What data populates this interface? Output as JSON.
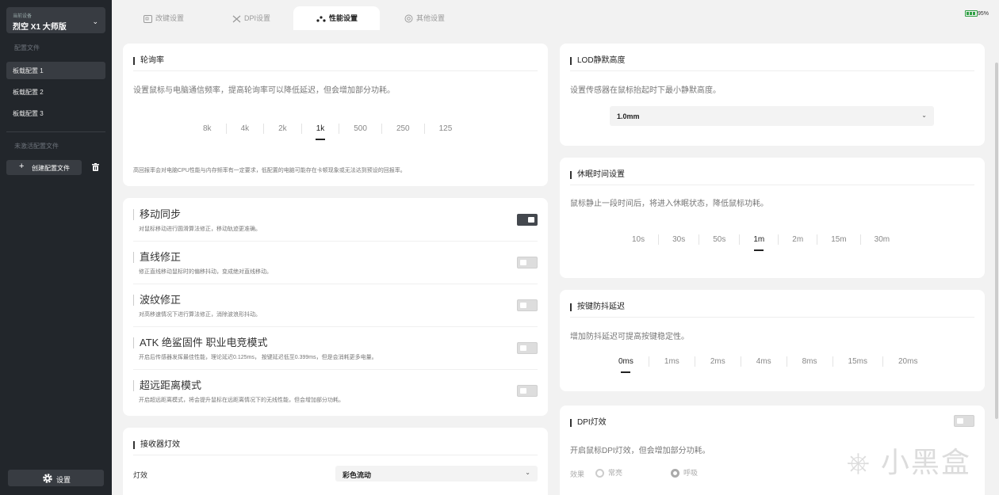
{
  "sidebar": {
    "device_caption": "当前设备",
    "device_name": "烈空 X1 大师版",
    "profiles_caption": "配置文件",
    "profiles": [
      "板载配置 1",
      "板载配置 2",
      "板载配置 3"
    ],
    "inactive_caption": "未激活配置文件",
    "create_label": "创建配置文件",
    "settings_label": "设置"
  },
  "tabs": [
    {
      "label": "改键设置",
      "icon": "keyboard-icon"
    },
    {
      "label": "DPI设置",
      "icon": "cross-arrows-icon"
    },
    {
      "label": "性能设置",
      "icon": "dots-icon",
      "active": true
    },
    {
      "label": "其他设置",
      "icon": "gear-icon"
    }
  ],
  "battery": {
    "percent": "95%",
    "color": "#2ea043"
  },
  "polling": {
    "title": "轮询率",
    "desc": "设置鼠标与电脑通信频率，提高轮询率可以降低延迟，但会增加部分功耗。",
    "options": [
      "8k",
      "4k",
      "2k",
      "1k",
      "500",
      "250",
      "125"
    ],
    "selected": "1k",
    "note": "高回报率会对电脑CPU性能与内存频率有一定要求，低配置的电脑可能存在卡顿现象或无法达到预设的回报率。"
  },
  "features": [
    {
      "title": "移动同步",
      "desc": "对鼠标移动进行圆滑算法修正，移动轨迹更准确。",
      "on": true
    },
    {
      "title": "直线修正",
      "desc": "修正直线移动鼠标时的偏移抖动，变成绝对直线移动。",
      "on": false
    },
    {
      "title": "波纹修正",
      "desc": "对高移速情况下进行算法修正，消除波浪形抖动。",
      "on": false
    },
    {
      "title": "ATK 绝鲨固件 职业电竞模式",
      "desc": "开启后传感器发挥最佳性能，理论延迟0.125ms， 按键延迟低至0.399ms，但是会消耗更多电量。",
      "on": false
    },
    {
      "title": "超远距离模式",
      "desc": "开启超远距离模式，将会提升鼠标在远距离情况下的无线性能，但会增加部分功耗。",
      "on": false
    }
  ],
  "receiver": {
    "title": "接收器灯效",
    "label": "灯效",
    "value": "彩色流动"
  },
  "lod": {
    "title": "LOD静默高度",
    "desc": "设置传感器在鼠标抬起时下最小静默高度。",
    "value": "1.0mm"
  },
  "sleep": {
    "title": "休眠时间设置",
    "desc": "鼠标静止一段时间后，将进入休眠状态，降低鼠标功耗。",
    "options": [
      "10s",
      "30s",
      "50s",
      "1m",
      "2m",
      "15m",
      "30m"
    ],
    "selected": "1m"
  },
  "debounce": {
    "title": "按键防抖延迟",
    "desc": "增加防抖延迟可提高按键稳定性。",
    "options": [
      "0ms",
      "1ms",
      "2ms",
      "4ms",
      "8ms",
      "15ms",
      "20ms"
    ],
    "selected": "0ms"
  },
  "dpi_light": {
    "title": "DPI灯效",
    "desc": "开启鼠标DPI灯效，但会增加部分功耗。",
    "effect_label": "效果",
    "effects": [
      "常亮",
      "呼吸"
    ],
    "selected": "呼吸",
    "on": false
  },
  "watermark": "小黑盒"
}
